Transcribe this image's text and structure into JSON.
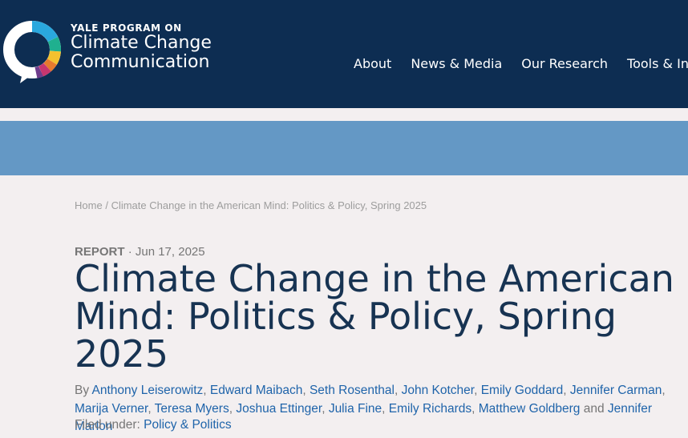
{
  "header": {
    "logo_kicker": "YALE PROGRAM ON",
    "logo_line1": "Climate Change",
    "logo_line2": "Communication",
    "nav": [
      "About",
      "News & Media",
      "Our Research",
      "Tools & In"
    ]
  },
  "breadcrumb": {
    "home": "Home",
    "separator": "/",
    "current": "Climate Change in the American Mind: Politics & Policy, Spring 2025"
  },
  "article": {
    "type": "REPORT",
    "date_sep": "·",
    "date": "Jun 17, 2025",
    "title": "Climate Change in the American Mind: Politics & Policy, Spring 2025",
    "by_label": "By",
    "authors": [
      "Anthony Leiserowitz",
      "Edward Maibach",
      "Seth Rosenthal",
      "John Kotcher",
      "Emily Goddard",
      "Jennifer Carman",
      "Marija Verner",
      "Teresa Myers",
      "Joshua Ettinger",
      "Julia Fine",
      "Emily Richards",
      "Matthew Goldberg",
      "Jennifer Marlon"
    ],
    "and_label": "and",
    "filed_label": "Filed under:",
    "filed_under": "Policy & Politics"
  },
  "colors": {
    "header_bg": "#0d2d52",
    "band": "#6498c5",
    "page_bg": "#f3eff0",
    "link": "#1f64aa",
    "title": "#173352"
  }
}
